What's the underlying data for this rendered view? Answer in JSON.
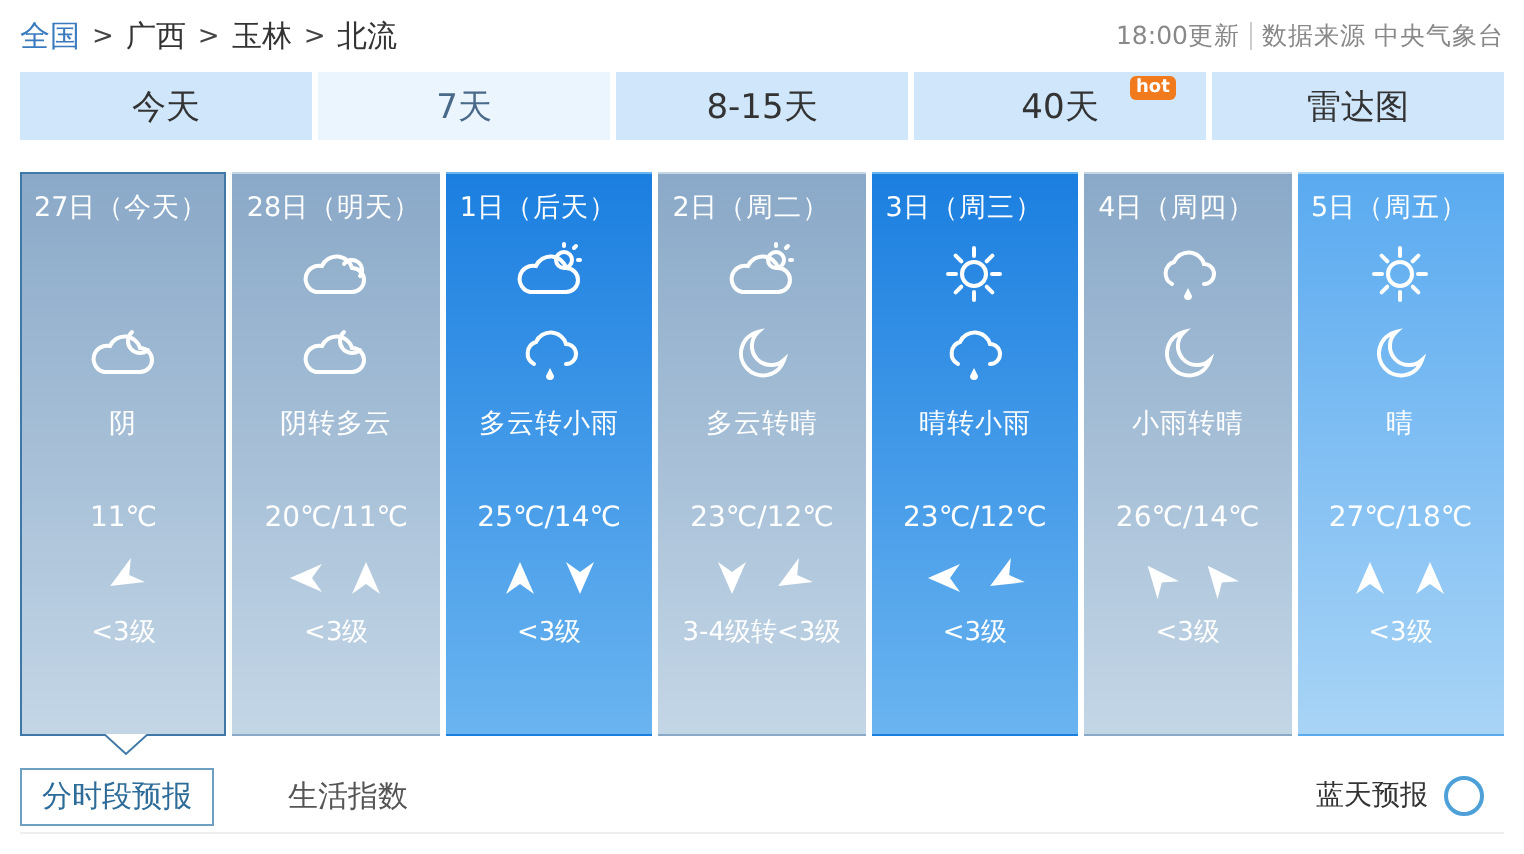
{
  "breadcrumb": [
    {
      "label": "全国",
      "link": true
    },
    {
      "label": "广西",
      "link": false
    },
    {
      "label": "玉林",
      "link": false
    },
    {
      "label": "北流",
      "link": false
    }
  ],
  "separator": ">",
  "update_time": "18:00更新",
  "source": "数据来源 中央气象台",
  "tabs": [
    {
      "label": "今天",
      "selected": false
    },
    {
      "label": "7天",
      "selected": true
    },
    {
      "label": "8-15天",
      "selected": false
    },
    {
      "label": "40天",
      "selected": false,
      "badge": "hot"
    },
    {
      "label": "雷达图",
      "selected": false
    }
  ],
  "days": [
    {
      "date": "27日（今天）",
      "kind": "grey",
      "selected": true,
      "icons": [
        {
          "kind": "cloud-moon"
        }
      ],
      "weather": "阴",
      "temp": "11℃",
      "winds": [
        {
          "kind": "down-left"
        }
      ],
      "wind_level": "<3级"
    },
    {
      "date": "28日（明天）",
      "kind": "grey",
      "selected": false,
      "icons": [
        {
          "kind": "cloud"
        },
        {
          "kind": "cloud-moon"
        }
      ],
      "weather": "阴转多云",
      "temp": "20℃/11℃",
      "winds": [
        {
          "kind": "left"
        },
        {
          "kind": "up"
        }
      ],
      "wind_level": "<3级"
    },
    {
      "date": "1日（后天）",
      "kind": "blue",
      "selected": false,
      "icons": [
        {
          "kind": "cloud-sun"
        },
        {
          "kind": "cloud-rain"
        }
      ],
      "weather": "多云转小雨",
      "temp": "25℃/14℃",
      "winds": [
        {
          "kind": "up"
        },
        {
          "kind": "down"
        }
      ],
      "wind_level": "<3级"
    },
    {
      "date": "2日（周二）",
      "kind": "grey",
      "selected": false,
      "icons": [
        {
          "kind": "cloud-sun"
        },
        {
          "kind": "moon"
        }
      ],
      "weather": "多云转晴",
      "temp": "23℃/12℃",
      "winds": [
        {
          "kind": "down"
        },
        {
          "kind": "down-left"
        }
      ],
      "wind_level": "3-4级转<3级"
    },
    {
      "date": "3日（周三）",
      "kind": "blue",
      "selected": false,
      "icons": [
        {
          "kind": "sun"
        },
        {
          "kind": "cloud-rain"
        }
      ],
      "weather": "晴转小雨",
      "temp": "23℃/12℃",
      "winds": [
        {
          "kind": "left"
        },
        {
          "kind": "down-left"
        }
      ],
      "wind_level": "<3级"
    },
    {
      "date": "4日（周四）",
      "kind": "grey",
      "selected": false,
      "icons": [
        {
          "kind": "cloud-rain"
        },
        {
          "kind": "moon"
        }
      ],
      "weather": "小雨转晴",
      "temp": "26℃/14℃",
      "winds": [
        {
          "kind": "up-left"
        },
        {
          "kind": "up-left"
        }
      ],
      "wind_level": "<3级"
    },
    {
      "date": "5日（周五）",
      "kind": "light",
      "selected": false,
      "icons": [
        {
          "kind": "sun"
        },
        {
          "kind": "moon"
        }
      ],
      "weather": "晴",
      "temp": "27℃/18℃",
      "winds": [
        {
          "kind": "up"
        },
        {
          "kind": "up"
        }
      ],
      "wind_level": "<3级"
    }
  ],
  "bottom_tabs": [
    {
      "label": "分时段预报",
      "selected": true
    },
    {
      "label": "生活指数",
      "selected": false
    }
  ],
  "extra_link": "蓝天预报"
}
